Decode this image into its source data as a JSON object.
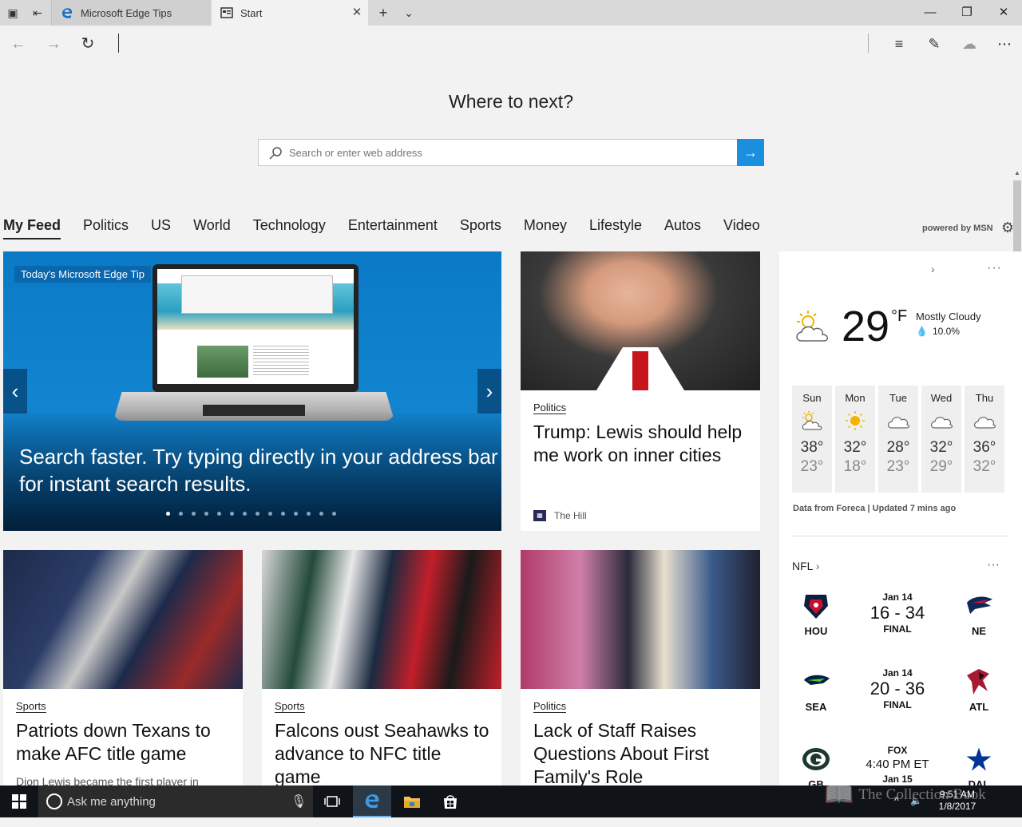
{
  "tabs": [
    {
      "title": "Microsoft Edge Tips",
      "active": false
    },
    {
      "title": "Start",
      "active": true
    }
  ],
  "hero": {
    "title": "Where to next?",
    "search_placeholder": "Search or enter web address"
  },
  "categories": [
    "My Feed",
    "Politics",
    "US",
    "World",
    "Technology",
    "Entertainment",
    "Sports",
    "Money",
    "Lifestyle",
    "Autos",
    "Video"
  ],
  "powered_by": "powered by MSN",
  "carousel": {
    "label": "Today's Microsoft Edge Tip",
    "caption": "Search faster. Try typing directly in your address bar for instant search results.",
    "dot_count": 14,
    "active_dot": 0
  },
  "cards": [
    {
      "category": "Politics",
      "title": "Trump: Lewis should help me work on inner cities",
      "source": "The Hill"
    },
    {
      "category": "Sports",
      "title": "Patriots down Texans to make AFC title game",
      "snippet": "Dion Lewis became the first player in"
    },
    {
      "category": "Sports",
      "title": "Falcons oust Seahawks to advance to NFC title game"
    },
    {
      "category": "Politics",
      "title": "Lack of Staff Raises Questions About First Family's Role"
    }
  ],
  "weather": {
    "temperature": "29",
    "unit": "°F",
    "condition": "Mostly Cloudy",
    "precip": "10.0%",
    "forecast": [
      {
        "day": "Sun",
        "icon": "partly-sunny-icon",
        "high": "38°",
        "low": "23°"
      },
      {
        "day": "Mon",
        "icon": "sunny-icon",
        "high": "32°",
        "low": "18°"
      },
      {
        "day": "Tue",
        "icon": "cloudy-icon",
        "high": "28°",
        "low": "23°"
      },
      {
        "day": "Wed",
        "icon": "cloudy-icon",
        "high": "32°",
        "low": "29°"
      },
      {
        "day": "Thu",
        "icon": "cloudy-icon",
        "high": "36°",
        "low": "32°"
      }
    ],
    "credit": "Data from Foreca | Updated 7 mins ago"
  },
  "nfl": {
    "title": "NFL",
    "games": [
      {
        "date": "Jan 14",
        "score": "16 - 34",
        "status": "FINAL",
        "home": "HOU",
        "away": "NE"
      },
      {
        "date": "Jan 14",
        "score": "20 - 36",
        "status": "FINAL",
        "home": "SEA",
        "away": "ATL"
      },
      {
        "date": "FOX",
        "score": "4:40 PM ET",
        "status": "Jan 15",
        "home": "GB",
        "away": "DAL"
      }
    ]
  },
  "taskbar": {
    "search_placeholder": "Ask me anything",
    "time": "9:51 AM",
    "date": "1/8/2017"
  },
  "watermark": "The Collection Book",
  "colors": {
    "accent": "#1a8fe0",
    "tabstrip": "#d9d9d9",
    "page": "#f2f2f2",
    "taskbar": "#101418"
  }
}
